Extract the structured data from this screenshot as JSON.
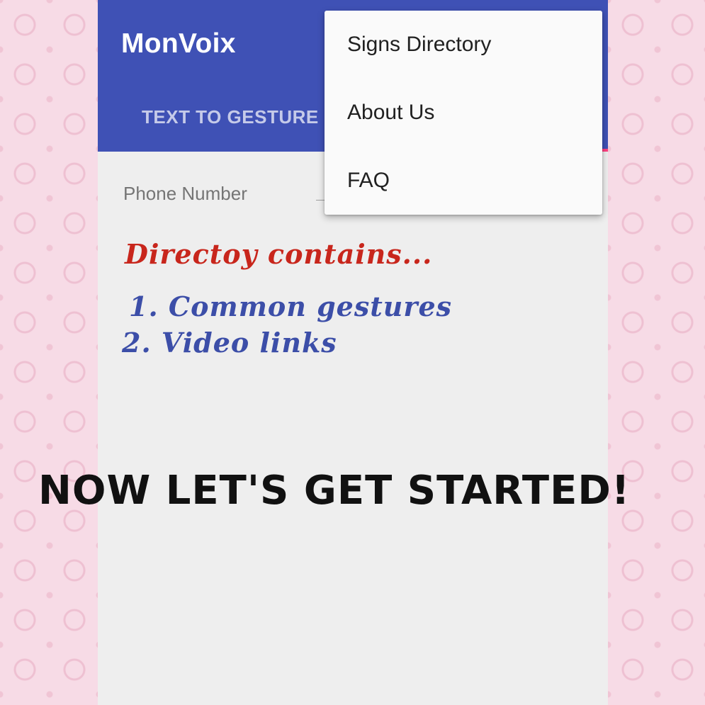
{
  "app": {
    "title": "MonVoix"
  },
  "tabs": [
    {
      "label": "TEXT TO GESTURE"
    }
  ],
  "form": {
    "phone_label": "Phone Number"
  },
  "overflow_menu": {
    "items": [
      {
        "label": "Signs Directory"
      },
      {
        "label": "About Us"
      },
      {
        "label": "FAQ"
      }
    ]
  },
  "overlay": {
    "heading": "Directoy contains...",
    "items": [
      "1. Common gestures",
      "2. Video links"
    ],
    "banner": "NOW LET'S GET STARTED!"
  },
  "colors": {
    "appbar": "#3f51b5",
    "tab_indicator": "#ff4081",
    "heading": "#c8261c",
    "list": "#3c4ea8",
    "background_pink": "#f7dbe6"
  }
}
